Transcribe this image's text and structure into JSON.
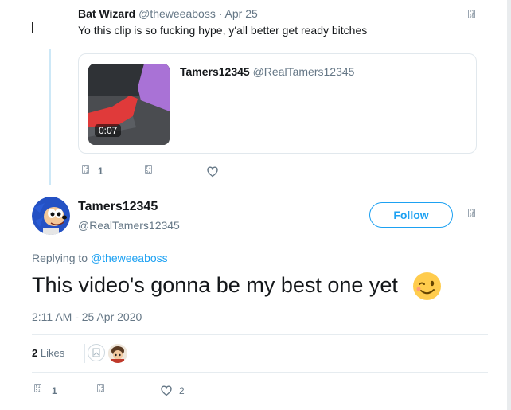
{
  "colors": {
    "accent": "#1da1f2",
    "muted": "#657786",
    "text": "#14171a",
    "thread_line": "#cde8f7",
    "emoji": "#ffcc4d"
  },
  "parent_tweet": {
    "display_name": "Bat Wizard",
    "handle": "@theweeaboss",
    "separator": "·",
    "date": "Apr 25",
    "text": "Yo this clip is so fucking hype, y'all better get ready bitches",
    "quoted_card": {
      "display_name": "Tamers12345",
      "handle": "@RealTamers12345",
      "video_duration": "0:07"
    },
    "actions": {
      "reply_count": "1",
      "reply_icon": "reply-icon",
      "retweet_icon": "retweet-icon",
      "like_icon": "heart-icon"
    }
  },
  "main_tweet": {
    "display_name": "Tamers12345",
    "handle": "@RealTamers12345",
    "follow_label": "Follow",
    "replying_prefix": "Replying to",
    "replying_to": "@theweeaboss",
    "text": "This video's gonna be my best one yet",
    "emoji": "winking-face",
    "timestamp": "2:11 AM - 25 Apr 2020",
    "likes_count": "2",
    "likes_label": "Likes",
    "actions": {
      "reply_count": "1",
      "like_count": "2"
    }
  }
}
